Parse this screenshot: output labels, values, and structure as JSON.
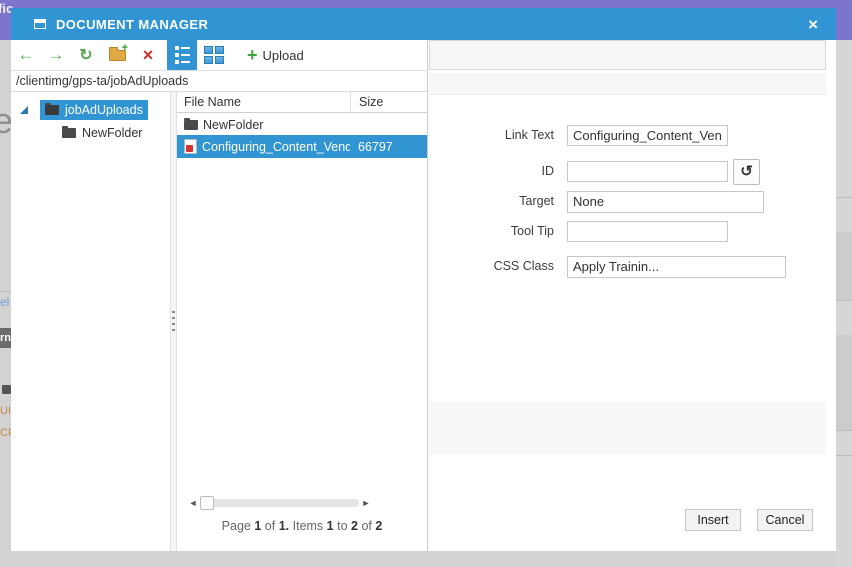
{
  "window": {
    "title": "DOCUMENT MANAGER",
    "close_glyph": "×"
  },
  "toolbar": {
    "upload_label": "Upload",
    "glyphs": {
      "back": "←",
      "forward": "→",
      "refresh": "↻",
      "new_folder_plus": "+",
      "delete": "×",
      "upload_plus": "+"
    }
  },
  "address": {
    "path": "/clientimg/gps-ta/jobAdUploads"
  },
  "tree": {
    "root_label": "jobAdUploads",
    "child_label": "NewFolder"
  },
  "file_list": {
    "columns": {
      "name": "File Name",
      "size": "Size"
    },
    "rows": [
      {
        "name": "NewFolder",
        "size": ""
      },
      {
        "name": "Configuring_Content_Vendo",
        "size": "66797"
      }
    ],
    "scrollbar": {
      "left_glyph": "◄",
      "right_glyph": "►"
    },
    "pager": {
      "page_word": "Page",
      "page_num": "1",
      "of1": "of",
      "page_total": "1.",
      "items_word": "Items",
      "item_from": "1",
      "to_word": "to",
      "item_to": "2",
      "of2": "of",
      "item_total": "2"
    }
  },
  "form": {
    "link_text": {
      "label": "Link Text",
      "value": "Configuring_Content_Vendor"
    },
    "id_field": {
      "label": "ID",
      "value": "",
      "refresh_glyph": "↺"
    },
    "target": {
      "label": "Target",
      "value": "None",
      "arrow": "▾"
    },
    "tool_tip": {
      "label": "Tool Tip",
      "value": ""
    },
    "css_class": {
      "label": "CSS Class",
      "value": "Apply Trainin...",
      "arrow": "▼"
    }
  },
  "footer": {
    "insert_label": "Insert",
    "cancel_label": "Cancel"
  },
  "colors": {
    "titlebar_blue": "#3095d2",
    "selection_blue": "#3095d2",
    "overlay_purple": "#7d74ce"
  },
  "background_page": {
    "topbar_fragment": "fic",
    "heading_fragment": "e",
    "link_fragment": "el",
    "button_fragment": "rn",
    "text_fragment_1": "UI",
    "text_fragment_2": "CR"
  }
}
